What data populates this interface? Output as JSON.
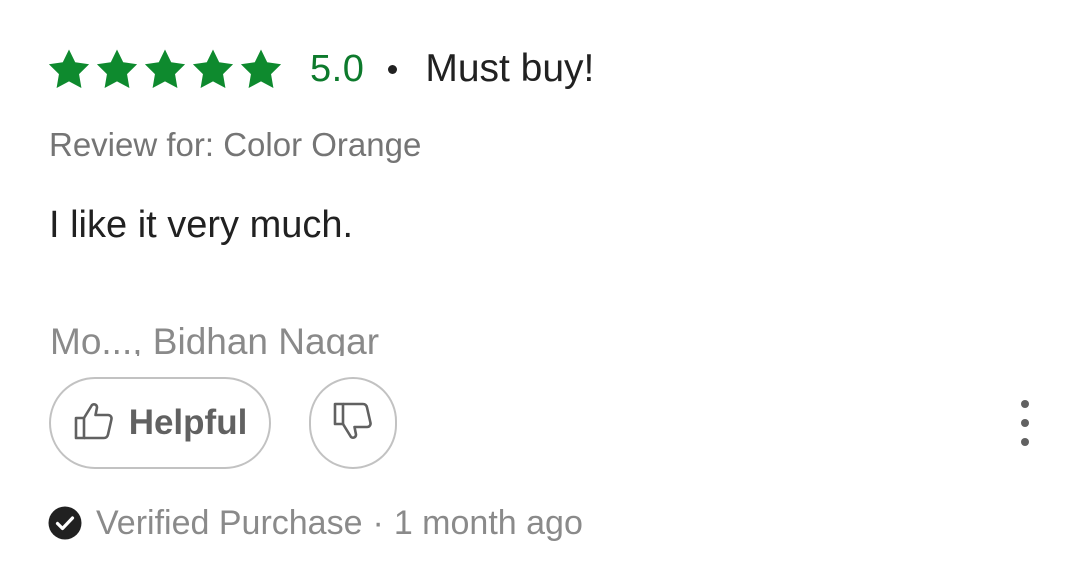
{
  "review": {
    "rating": 5,
    "rating_max": 5,
    "score_label": "5.0",
    "title": "Must buy!",
    "variant": "Review for: Color Orange",
    "body": "I like it very much.",
    "author": "Mo..., Bidhan Nagar",
    "helpful_label": "Helpful",
    "verified_label": "Verified Purchase",
    "separator": "·",
    "time_ago": "1 month ago"
  },
  "colors": {
    "star": "#0e8a2e",
    "score": "#0d7a2c",
    "muted_text": "#8a8a8a",
    "button_border": "#c2c2c2"
  },
  "icons": {
    "star": "star-icon",
    "helpful": "thumbs-up-icon",
    "dislike": "thumbs-down-icon",
    "more": "more-vertical-icon",
    "verified": "check-circle-icon"
  }
}
